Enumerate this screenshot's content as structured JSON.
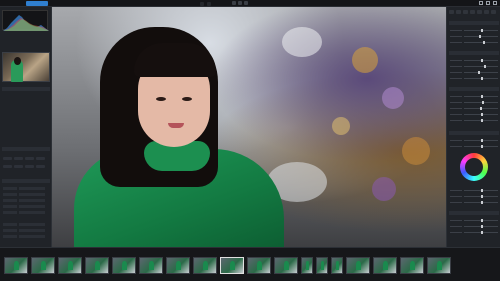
{
  "app": {
    "title": ""
  },
  "topbar": {
    "active_tab": "",
    "center_items": [
      "",
      ""
    ]
  },
  "left_panel": {
    "section_titles": [
      "",
      "",
      ""
    ],
    "rows": [
      {
        "label": "",
        "value": ""
      },
      {
        "label": "",
        "value": ""
      },
      {
        "label": "",
        "value": ""
      },
      {
        "label": "",
        "value": ""
      },
      {
        "label": "",
        "value": ""
      },
      {
        "label": "",
        "value": ""
      },
      {
        "label": "",
        "value": ""
      },
      {
        "label": "",
        "value": ""
      },
      {
        "label": "",
        "value": ""
      }
    ]
  },
  "filmstrip": {
    "label": "",
    "frames": [
      {
        "type": "landscape"
      },
      {
        "type": "landscape"
      },
      {
        "type": "landscape"
      },
      {
        "type": "landscape"
      },
      {
        "type": "landscape"
      },
      {
        "type": "landscape"
      },
      {
        "type": "landscape"
      },
      {
        "type": "landscape"
      },
      {
        "type": "landscape",
        "selected": true
      },
      {
        "type": "landscape"
      },
      {
        "type": "landscape"
      },
      {
        "type": "portrait"
      },
      {
        "type": "portrait"
      },
      {
        "type": "portrait"
      },
      {
        "type": "landscape"
      },
      {
        "type": "landscape"
      },
      {
        "type": "landscape"
      },
      {
        "type": "landscape"
      }
    ]
  },
  "colors": {
    "accent": "#2f7fd0",
    "panel": "#202328",
    "background": "#1b1d21"
  },
  "icons": [
    "histogram-icon",
    "color-wheel-icon",
    "minimize-icon",
    "maximize-icon",
    "close-icon"
  ]
}
